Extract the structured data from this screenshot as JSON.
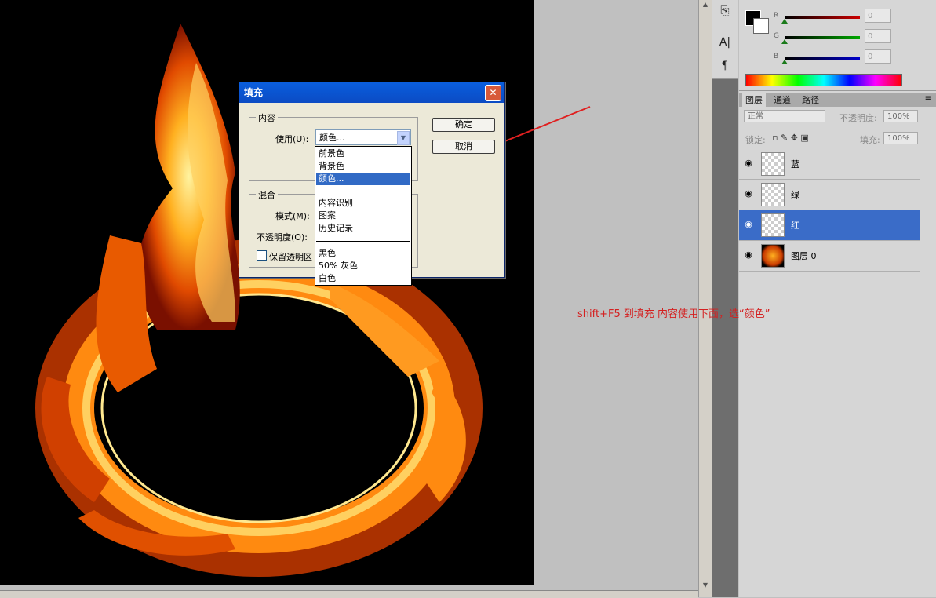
{
  "fill_dialog": {
    "title": "填充",
    "content_group": "内容",
    "use_label": "使用(U):",
    "use_value": "颜色...",
    "blend_group": "混合",
    "mode_label": "模式(M):",
    "opacity_label": "不透明度(O):",
    "preserve_label": "保留透明区",
    "ok_label": "确定",
    "cancel_label": "取消",
    "close_glyph": "✕"
  },
  "dropdown": {
    "items": [
      "前景色",
      "背景色",
      "颜色...",
      "内容识别",
      "图案",
      "历史记录",
      "黑色",
      "50% 灰色",
      "白色"
    ],
    "highlighted_index": 2
  },
  "annotation": {
    "text": "shift+F5   到填充  内容使用下面，选“颜色”",
    "color": "#d42020"
  },
  "color_panel": {
    "channels": [
      {
        "label": "R",
        "value": "0",
        "track": "#cc0000"
      },
      {
        "label": "G",
        "value": "0",
        "track": "#00a800"
      },
      {
        "label": "B",
        "value": "0",
        "track": "#0000cc"
      }
    ]
  },
  "layers_panel": {
    "tabs": [
      "图层",
      "通道",
      "路径"
    ],
    "blend_mode": "正常",
    "opacity_label": "不透明度:",
    "opacity_value": "100%",
    "lock_label": "锁定:",
    "fill_label": "填充:",
    "fill_value": "100%",
    "layers": [
      {
        "name": "蓝",
        "selected": false
      },
      {
        "name": "绿",
        "selected": false
      },
      {
        "name": "红",
        "selected": true
      },
      {
        "name": "图层 0",
        "selected": false
      }
    ]
  },
  "tools": {
    "items": [
      "paragraph-icon",
      "character-icon",
      "history-icon"
    ]
  }
}
